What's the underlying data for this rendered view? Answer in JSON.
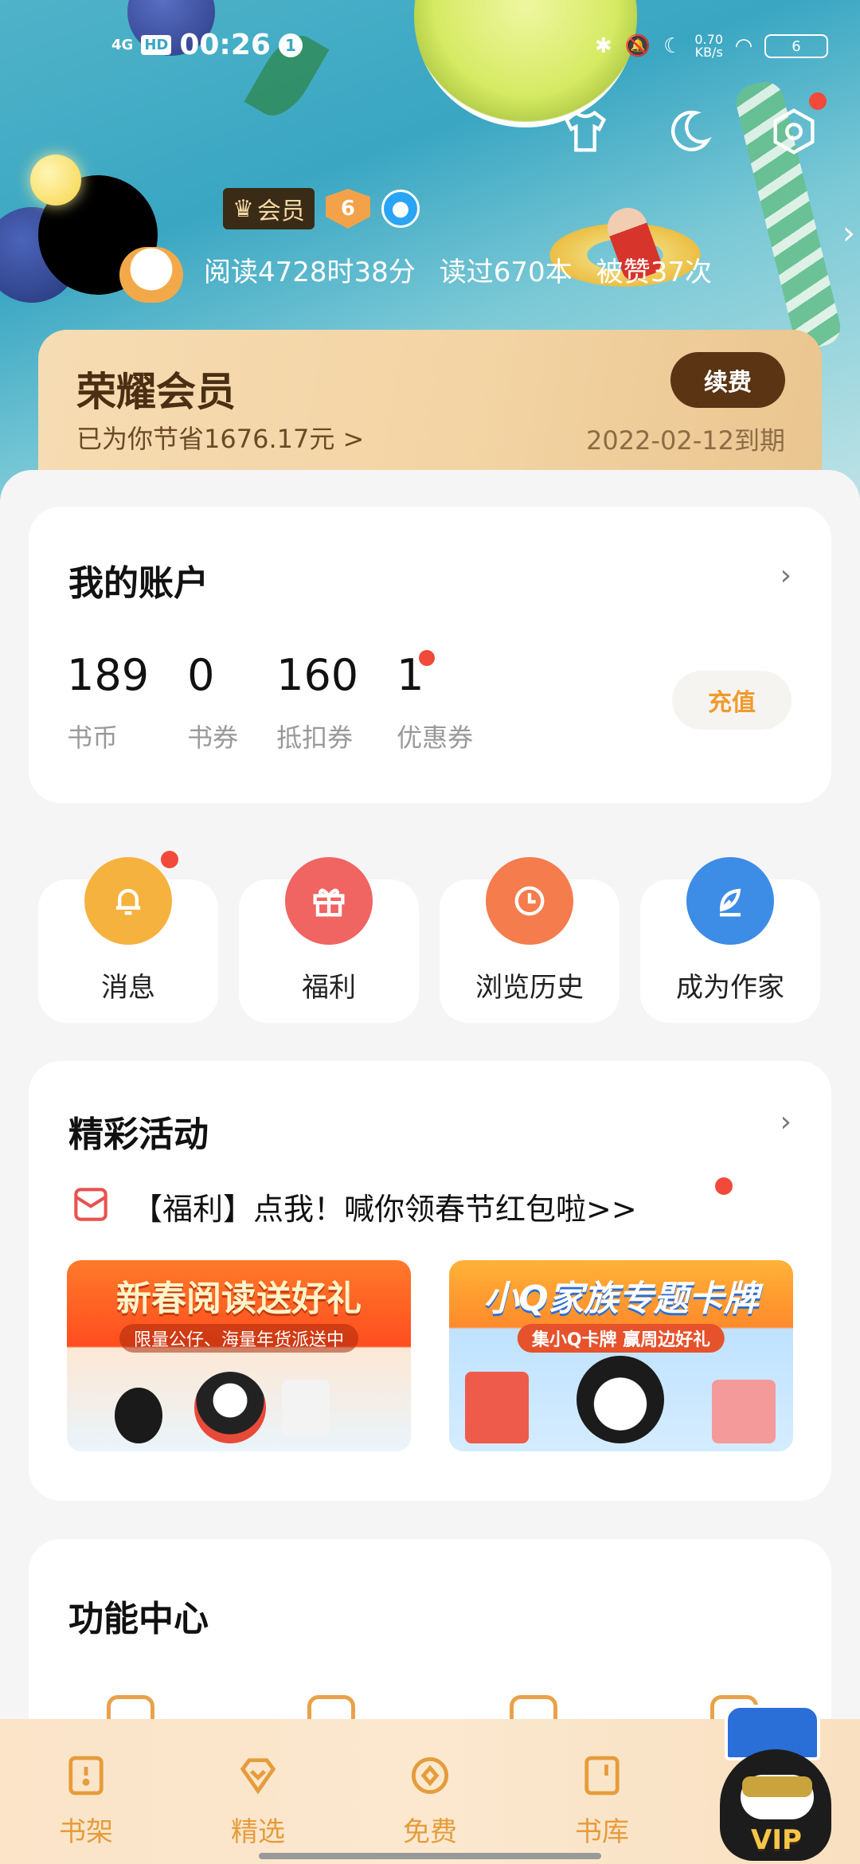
{
  "status_bar": {
    "network": "4G",
    "hd": "HD",
    "time": "00:26",
    "notification_count": "1",
    "speed_value": "0.70",
    "speed_unit": "KB/s",
    "battery": "6"
  },
  "profile": {
    "vip_badge": "会员",
    "level": "6",
    "stats": [
      "阅读4728时38分",
      "读过670本",
      "被赞37次"
    ]
  },
  "vip_card": {
    "title": "荣耀会员",
    "saved": "已为你节省1676.17元 >",
    "renew_label": "续费",
    "expire": "2022-02-12到期"
  },
  "account": {
    "title": "我的账户",
    "items": [
      {
        "value": "189",
        "label": "书币"
      },
      {
        "value": "0",
        "label": "书券"
      },
      {
        "value": "160",
        "label": "抵扣券"
      },
      {
        "value": "1",
        "label": "优惠券"
      }
    ],
    "recharge_label": "充值"
  },
  "quick_actions": [
    {
      "label": "消息",
      "icon": "bell-icon"
    },
    {
      "label": "福利",
      "icon": "gift-icon"
    },
    {
      "label": "浏览历史",
      "icon": "clock-icon"
    },
    {
      "label": "成为作家",
      "icon": "pen-icon"
    }
  ],
  "activities": {
    "title": "精彩活动",
    "promo_text": "【福利】点我！喊你领春节红包啦>>",
    "banners": [
      {
        "title": "新春阅读送好礼",
        "subtitle": "限量公仔、海量年货派送中"
      },
      {
        "title": "小Q家族专题卡牌",
        "subtitle": "集小Q卡牌 赢周边好礼"
      }
    ]
  },
  "function_center": {
    "title": "功能中心"
  },
  "bottom_nav": [
    {
      "label": "书架",
      "icon": "bookshelf-icon"
    },
    {
      "label": "精选",
      "icon": "diamond-icon"
    },
    {
      "label": "免费",
      "icon": "coin-icon"
    },
    {
      "label": "书库",
      "icon": "library-icon"
    }
  ],
  "mascot": {
    "text": "VIP"
  },
  "colors": {
    "accent": "#f09a2d",
    "vip_brown": "#5a3413",
    "red_dot": "#f14a3b"
  }
}
